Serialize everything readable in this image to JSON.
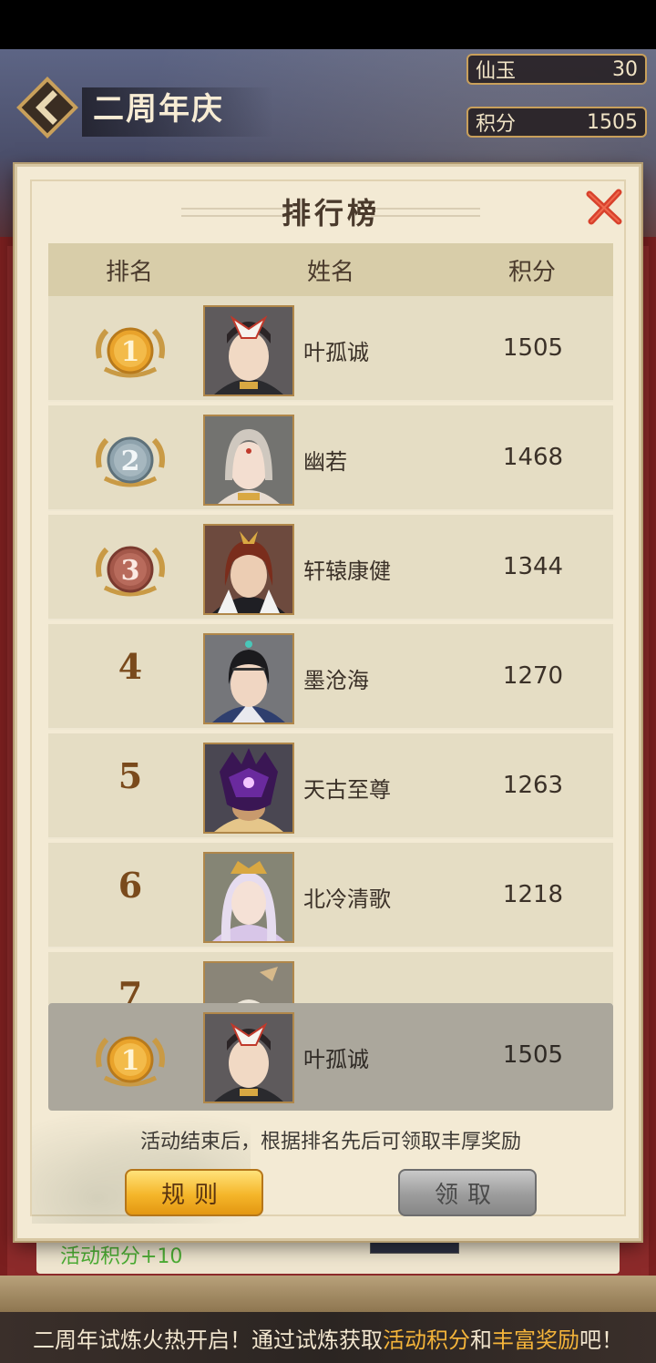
{
  "header": {
    "title": "二周年庆",
    "currencies": [
      {
        "label": "仙玉",
        "value": "30"
      },
      {
        "label": "积分",
        "value": "1505"
      }
    ]
  },
  "modal": {
    "title": "排行榜",
    "columns": {
      "rank": "排名",
      "name": "姓名",
      "score": "积分"
    },
    "rows": [
      {
        "rank": "1",
        "name": "叶孤诚",
        "score": "1505",
        "medal": "gold"
      },
      {
        "rank": "2",
        "name": "幽若",
        "score": "1468",
        "medal": "silver"
      },
      {
        "rank": "3",
        "name": "轩辕康健",
        "score": "1344",
        "medal": "bronze"
      },
      {
        "rank": "4",
        "name": "墨沧海",
        "score": "1270"
      },
      {
        "rank": "5",
        "name": "天古至尊",
        "score": "1263"
      },
      {
        "rank": "6",
        "name": "北冷清歌",
        "score": "1218"
      },
      {
        "rank": "7",
        "name": "",
        "score": ""
      }
    ],
    "self": {
      "rank": "1",
      "name": "叶孤诚",
      "score": "1505",
      "medal": "gold"
    },
    "hint": "活动结束后，根据排名先后可领取丰厚奖励",
    "buttons": {
      "rules": "规则",
      "claim": "领取"
    }
  },
  "background": {
    "activity_points": "活动积分+10"
  },
  "banner": {
    "part1": "二周年试炼火热开启！通过试炼获取",
    "highlight1": "活动积分",
    "part2": "和",
    "highlight2": "丰富奖励",
    "part3": "吧！"
  },
  "colors": {
    "gold_medal": "#e9a32b",
    "silver_medal": "#8fa3ad",
    "bronze_medal": "#a4584a",
    "rules_button": "#f5b62a",
    "claim_button": "#9c9c9c",
    "close_red": "#d8412c"
  }
}
